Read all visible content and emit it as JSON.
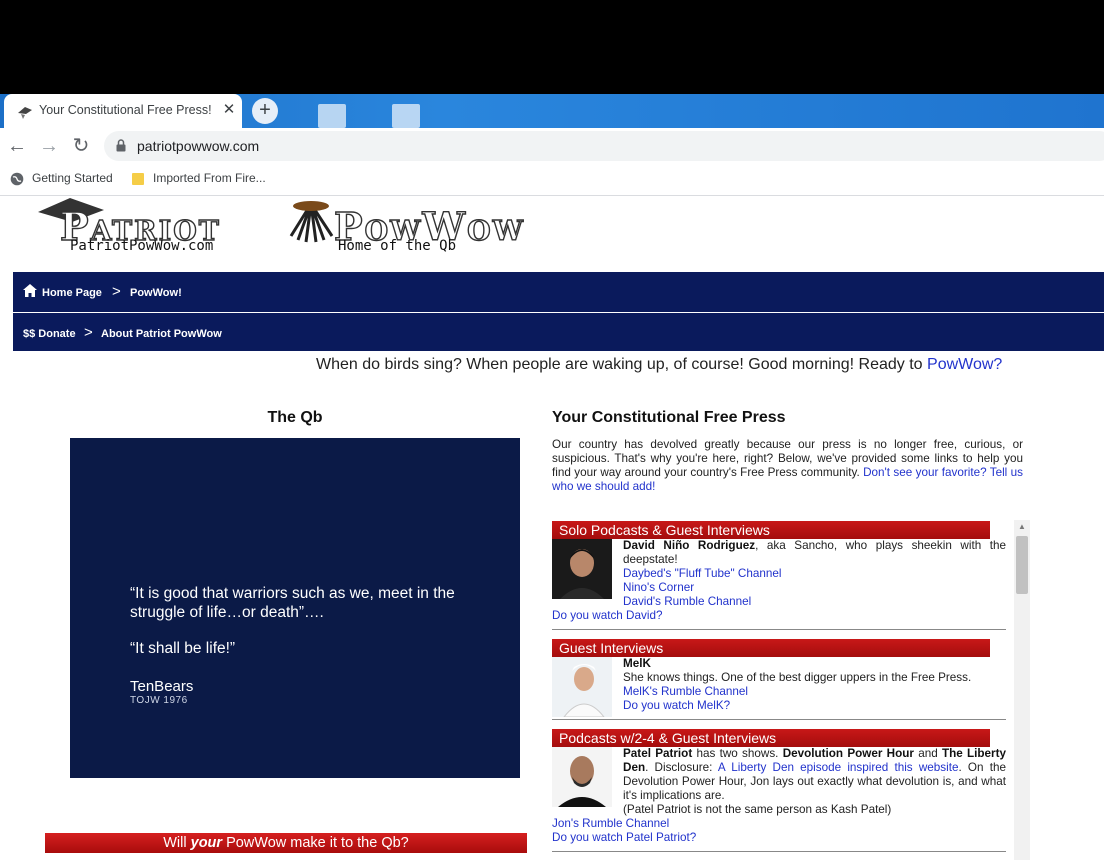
{
  "browser": {
    "tab_title": "Your Constitutional Free Press!",
    "close_glyph": "✕",
    "new_tab_glyph": "+",
    "url": "patriotpowwow.com",
    "back_glyph": "←",
    "forward_glyph": "→",
    "reload_glyph": "↻",
    "bookmarks": [
      "Getting Started",
      "Imported From Fire..."
    ]
  },
  "header": {
    "logo_word1": "Patriot",
    "logo_word2": "PowWow",
    "logo_sub1": "PatriotPowWow.com",
    "logo_sub2": "Home of the Qb"
  },
  "menu1": {
    "home": "Home Page",
    "sep": ">",
    "powwow": "PowWow!"
  },
  "menu2": {
    "donate": "$$ Donate",
    "sep": ">",
    "about": "About Patriot PowWow"
  },
  "tagline": {
    "text": "When do birds sing? When people are waking up, of course! Good morning! Ready to ",
    "link": "PowWow?"
  },
  "qb": {
    "heading": "The Qb",
    "quote1": "“It is good that warriors such as we, meet in the struggle of life…or death”….",
    "quote2": "“It shall be life!”",
    "author": "TenBears",
    "author_sub": "TOJW 1976",
    "banner_pre": "Will ",
    "banner_em": "your",
    "banner_post": " PowWow make it to the Qb?"
  },
  "press": {
    "heading": "Your Constitutional Free Press",
    "intro": "Our country has devolved greatly because our press is no longer free, curious, or suspicious. That's why you're here, right? Below, we've provided some links to help you find your way around your country's Free Press community. ",
    "intro_link": "Don't see your favorite? Tell us who we should add!"
  },
  "sections": [
    {
      "banner": "Solo Podcasts & Guest Interviews",
      "name": "David Niño Rodriguez",
      "desc": ", aka Sancho, who plays sheekin with the deepstate!",
      "links": [
        "Daybed's \"Fluff Tube\" Channel",
        "Nino's Corner",
        "David's Rumble Channel"
      ],
      "cta": "Do you watch David?"
    },
    {
      "banner": "Guest Interviews",
      "name": "MelK",
      "desc": "She knows things. One of the best digger uppers in the Free Press.",
      "links": [
        "MelK's Rumble Channel"
      ],
      "cta": "Do you watch MelK?"
    },
    {
      "banner": "Podcasts w/2-4 & Guest Interviews",
      "name": "Patel Patriot",
      "desc_a": " has two shows. ",
      "show1": "Devolution Power Hour",
      "and": " and ",
      "show2": "The Liberty Den",
      "disclosure": ". Disclosure: ",
      "disc_link": "A Liberty Den episode inspired this website",
      "desc_b": ". On the Devolution Power Hour, Jon lays out exactly what devolution is, and what it's implications are.",
      "note": "(Patel Patriot is not the same person as Kash Patel)",
      "links": [
        "Jon's Rumble Channel"
      ],
      "cta": "Do you watch Patel Patriot?"
    }
  ],
  "colors": {
    "navy": "#0a1a5c",
    "banner_red": "#c81818",
    "link_blue": "#2233cc"
  }
}
